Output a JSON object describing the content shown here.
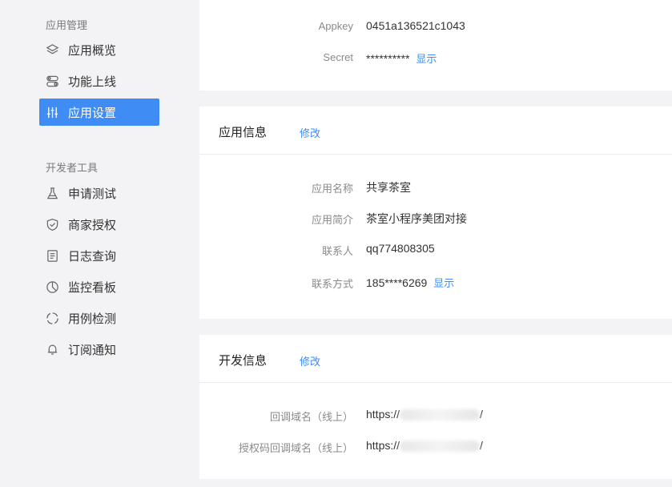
{
  "sidebar": {
    "app_group": "应用管理",
    "dev_group": "开发者工具",
    "app_items": [
      {
        "label": "应用概览",
        "icon": "layers-icon"
      },
      {
        "label": "功能上线",
        "icon": "toggle-icon"
      },
      {
        "label": "应用设置",
        "icon": "sliders-icon",
        "active": true
      }
    ],
    "dev_items": [
      {
        "label": "申请测试",
        "icon": "flask-icon"
      },
      {
        "label": "商家授权",
        "icon": "shield-check-icon"
      },
      {
        "label": "日志查询",
        "icon": "document-icon"
      },
      {
        "label": "监控看板",
        "icon": "pie-chart-icon"
      },
      {
        "label": "用例检测",
        "icon": "circle-dashed-icon"
      },
      {
        "label": "订阅通知",
        "icon": "bell-icon"
      }
    ]
  },
  "keys": {
    "appkey_label": "Appkey",
    "appkey_value": "0451a136521c1043",
    "secret_label": "Secret",
    "secret_value": "**********",
    "show_label": "显示"
  },
  "app_info": {
    "title": "应用信息",
    "edit_label": "修改",
    "name_label": "应用名称",
    "name_value": "共享茶室",
    "desc_label": "应用简介",
    "desc_value": "茶室小程序美团对接",
    "contact_label": "联系人",
    "contact_value": "qq774808305",
    "phone_label": "联系方式",
    "phone_value": "185****6269",
    "show_label": "显示"
  },
  "dev_info": {
    "title": "开发信息",
    "edit_label": "修改",
    "callback_label": "回调域名（线上）",
    "callback_prefix": "https://",
    "callback_suffix": "/",
    "auth_callback_label": "授权码回调域名（线上）",
    "auth_callback_prefix": "https://",
    "auth_callback_suffix": "/"
  },
  "colors": {
    "accent": "#3f8cf5",
    "background": "#f3f3f5"
  }
}
